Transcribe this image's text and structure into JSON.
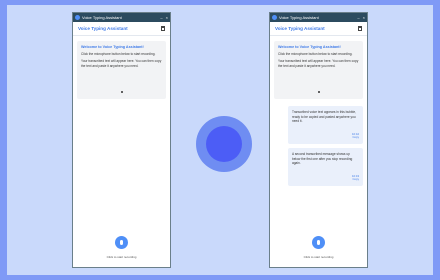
{
  "colors": {
    "frame": "#7f9af6",
    "canvas": "#c9d9fb",
    "accent": "#3f7be8",
    "mic": "#4f8ff7",
    "titlebar": "#2c4b5f",
    "record_button": "#4c5df6"
  },
  "left_window": {
    "titlebar_title": "Voice Typing Assistant",
    "controls": [
      "–",
      "×"
    ],
    "app_title": "Voice Typing Assistant",
    "welcome": {
      "heading": "Welcome to Voice Typing Assistant!",
      "line1": "Click the microphone button below to start recording.",
      "line2": "Your transcribed text will appear here. You can then copy the text and paste it anywhere you need."
    },
    "mic_caption": "Click to start recording"
  },
  "right_window": {
    "titlebar_title": "Voice Typing Assistant",
    "controls": [
      "–",
      "×"
    ],
    "app_title": "Voice Typing Assistant",
    "welcome": {
      "heading": "Welcome to Voice Typing Assistant!",
      "line1": "Click the microphone button below to start recording.",
      "line2": "Your transcribed text will appear here. You can then copy the text and paste it anywhere you need."
    },
    "transcripts": [
      {
        "text": "Transcribed voice text appears in this bubble, ready to be copied and pasted anywhere you need it.",
        "time": "10:42",
        "action": "Copy"
      },
      {
        "text": "A second transcribed message shows up below the first one after you stop recording again.",
        "time": "10:43",
        "action": "Copy"
      }
    ],
    "mic_caption": "Click to start recording"
  }
}
